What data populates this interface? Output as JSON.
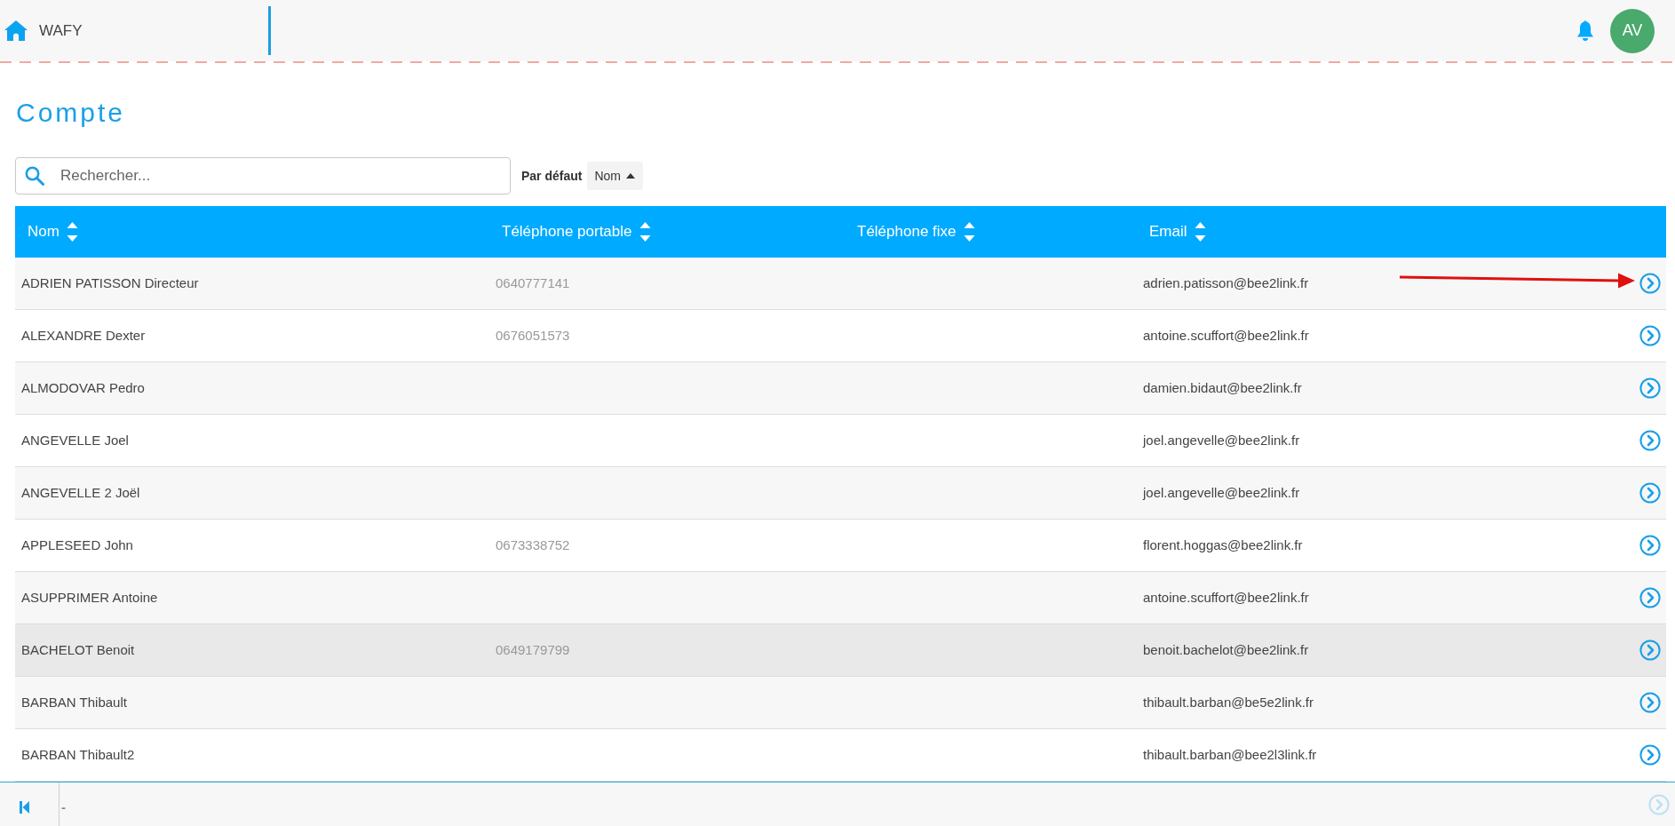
{
  "topbar": {
    "app_name": "WAFY",
    "avatar_initials": "AV"
  },
  "page": {
    "title": "Compte"
  },
  "search": {
    "placeholder": "Rechercher..."
  },
  "sort": {
    "label": "Par défaut",
    "field": "Nom",
    "ascending": true
  },
  "table": {
    "columns": [
      "Nom",
      "Téléphone portable",
      "Téléphone fixe",
      "Email"
    ],
    "rows": [
      {
        "name": "ADRIEN PATISSON Directeur",
        "mobile": "0640777141",
        "email": "adrien.patisson@bee2link.fr",
        "selected": false,
        "annotated": true
      },
      {
        "name": "ALEXANDRE Dexter",
        "mobile": "0676051573",
        "email": "antoine.scuffort@bee2link.fr",
        "selected": false,
        "annotated": false
      },
      {
        "name": "ALMODOVAR Pedro",
        "email": "damien.bidaut@bee2link.fr",
        "selected": false,
        "annotated": false
      },
      {
        "name": "ANGEVELLE Joel",
        "email": "joel.angevelle@bee2link.fr",
        "selected": false,
        "annotated": false
      },
      {
        "name": "ANGEVELLE 2 Joël",
        "email": "joel.angevelle@bee2link.fr",
        "selected": false,
        "annotated": false
      },
      {
        "name": "APPLESEED John",
        "mobile": "0673338752",
        "email": "florent.hoggas@bee2link.fr",
        "selected": false,
        "annotated": false
      },
      {
        "name": "ASUPPRIMER Antoine",
        "email": "antoine.scuffort@bee2link.fr",
        "selected": false,
        "annotated": false
      },
      {
        "name": "BACHELOT Benoit",
        "mobile": "0649179799",
        "email": "benoit.bachelot@bee2link.fr",
        "selected": true,
        "annotated": false
      },
      {
        "name": "BARBAN Thibault",
        "email": "thibault.barban@be5e2link.fr",
        "selected": false,
        "annotated": false
      },
      {
        "name": "BARBAN Thibault2",
        "email": "thibault.barban@bee2l3link.fr",
        "selected": false,
        "annotated": false
      }
    ]
  },
  "footer": {
    "first_page": {
      "disabled": false
    },
    "page_text": "-",
    "next_page": {
      "disabled": true
    }
  }
}
